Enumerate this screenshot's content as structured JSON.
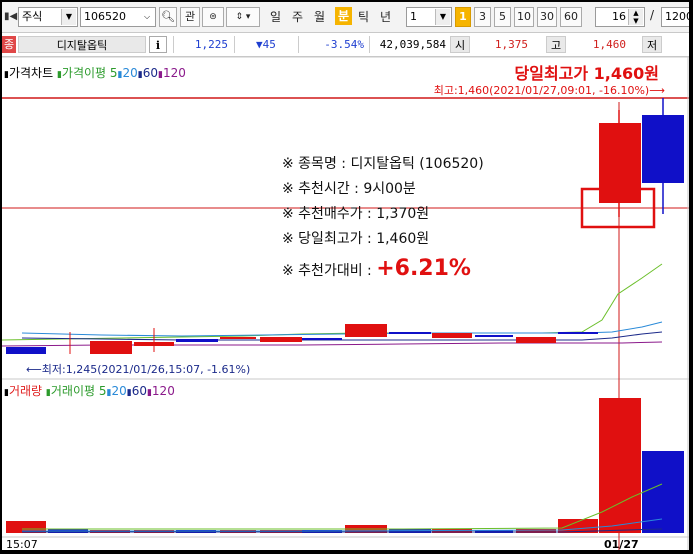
{
  "toolbar": {
    "market_type": "주식",
    "stock_code": "106520",
    "btn_gwan": "관",
    "period_labels": [
      "일",
      "주",
      "월",
      "분",
      "틱",
      "년"
    ],
    "active_period": "분",
    "interval_value": "1",
    "interval_active": "1",
    "interval_options": [
      "3",
      "5",
      "10",
      "30",
      "60"
    ],
    "zoom_value": "16",
    "slash": "/",
    "total_count": "1200"
  },
  "quote": {
    "tag": "종",
    "stock_name": "디지탈옵틱",
    "info_icon": "i",
    "price": "1,225",
    "change": "▼45",
    "change_pct": "-3.54%",
    "volume": "42,039,584",
    "open_label": "시",
    "open_value": "1,375",
    "high_label": "고",
    "high_value": "1,460",
    "low_label": "저"
  },
  "price_pane": {
    "legend": [
      {
        "label": "가격차트",
        "color": "#000000"
      },
      {
        "label": "가격이평",
        "color": "#2c9b2c"
      },
      {
        "label": "5",
        "color": "#2c9b2c"
      },
      {
        "label": "20",
        "color": "#1f6fd0"
      },
      {
        "label": "60",
        "color": "#1b2a8a"
      },
      {
        "label": "120",
        "color": "#8b1a8b"
      }
    ],
    "high_title": "당일최고가 1,460원",
    "high_note": "최고:1,460(2021/01/27,09:01, -16.10%)⟶",
    "low_note": "⟵최저:1,245(2021/01/26,15:07, -1.61%)"
  },
  "annotation": {
    "line1": "※ 종목명 : 디지탈옵틱 (106520)",
    "line2": "※ 추천시간 : 9시00분",
    "line3": "※ 추천매수가 : 1,370원",
    "line4": "※ 당일최고가 : 1,460원",
    "line5_label": "※ 추천가대비 : ",
    "line5_value": "+6.21%"
  },
  "volume_pane": {
    "legend": [
      {
        "label": "거래량",
        "color": "#e02020"
      },
      {
        "label": "거래이평",
        "color": "#2c9b2c"
      },
      {
        "label": "5",
        "color": "#2c9b2c"
      },
      {
        "label": "20",
        "color": "#1f6fd0"
      },
      {
        "label": "60",
        "color": "#1b2a8a"
      },
      {
        "label": "120",
        "color": "#8b1a8b"
      }
    ],
    "x_left": "15:07",
    "x_right": "01/27"
  },
  "colors": {
    "up": "#e01010",
    "down": "#1010c8",
    "ma5": "#6bbf2a",
    "ma20": "#2a8ad8",
    "ma60": "#1b2a8a",
    "ma120": "#8b1a8b",
    "ref_line": "#d01818",
    "highlight": "#e01010"
  }
}
